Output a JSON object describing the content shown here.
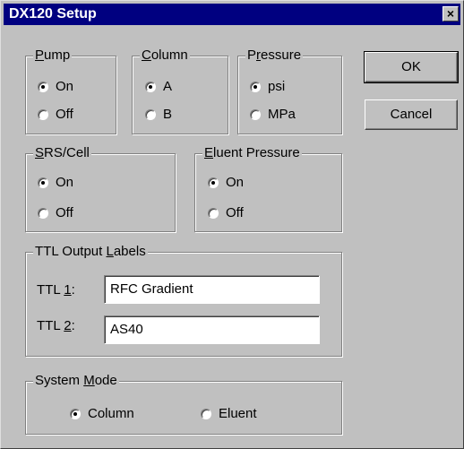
{
  "window": {
    "title": "DX120 Setup",
    "close_glyph": "×"
  },
  "pump": {
    "legend_u": "P",
    "legend_rest": "ump",
    "options": [
      {
        "label": "On",
        "checked": true
      },
      {
        "label": "Off",
        "checked": false
      }
    ]
  },
  "column": {
    "legend_u": "C",
    "legend_rest": "olumn",
    "options": [
      {
        "label": "A",
        "checked": true
      },
      {
        "label": "B",
        "checked": false
      }
    ]
  },
  "pressure": {
    "legend_pre": "P",
    "legend_u": "r",
    "legend_rest": "essure",
    "options": [
      {
        "label": "psi",
        "checked": true
      },
      {
        "label": "MPa",
        "checked": false
      }
    ]
  },
  "srs_cell": {
    "legend_u": "S",
    "legend_rest": "RS/Cell",
    "options": [
      {
        "label": "On",
        "checked": true
      },
      {
        "label": "Off",
        "checked": false
      }
    ]
  },
  "eluent_pressure": {
    "legend_u": "E",
    "legend_rest": "luent Pressure",
    "options": [
      {
        "label": "On",
        "checked": true
      },
      {
        "label": "Off",
        "checked": false
      }
    ]
  },
  "ttl": {
    "legend_pre": "TTL Output ",
    "legend_u": "L",
    "legend_rest": "abels",
    "fields": [
      {
        "label_pre": "TTL ",
        "label_u": "1",
        "label_post": ":",
        "value": "RFC Gradient"
      },
      {
        "label_pre": "TTL ",
        "label_u": "2",
        "label_post": ":",
        "value": "AS40"
      }
    ]
  },
  "system_mode": {
    "legend_pre": "System ",
    "legend_u": "M",
    "legend_rest": "ode",
    "options": [
      {
        "label": "Column",
        "checked": true
      },
      {
        "label": "Eluent",
        "checked": false
      }
    ]
  },
  "buttons": {
    "ok": "OK",
    "cancel": "Cancel"
  }
}
